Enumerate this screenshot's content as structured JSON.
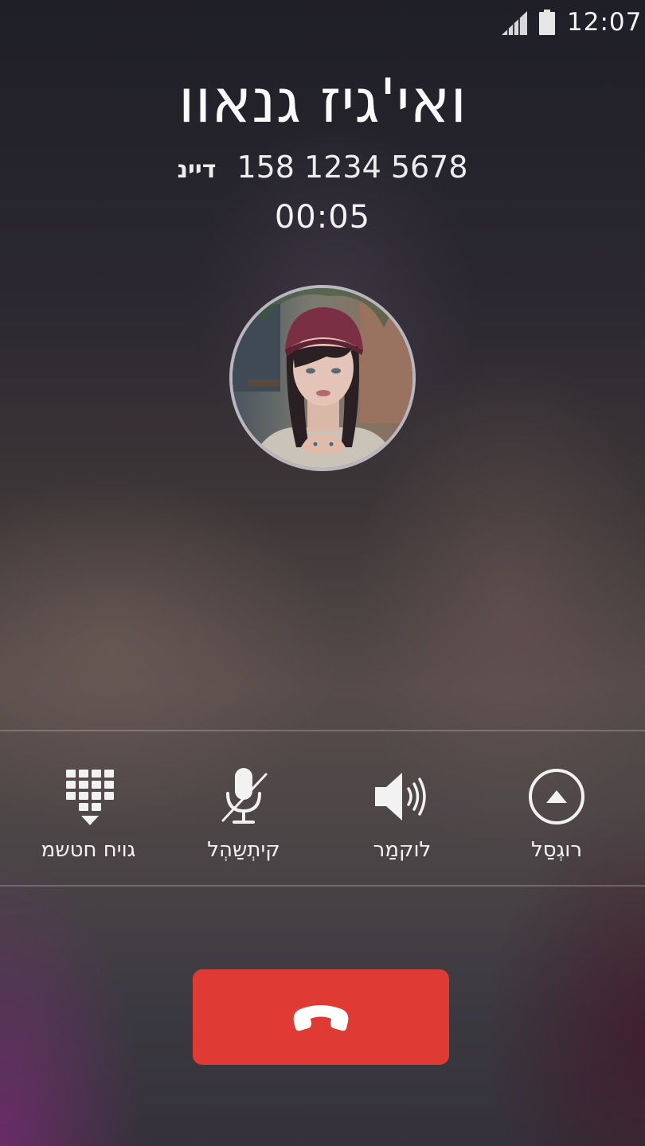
{
  "status_bar": {
    "time": "12:07",
    "signal_icon": "signal-strength-icon",
    "battery_icon": "battery-icon"
  },
  "call": {
    "caller_name": "ואי'גיז גנאוו",
    "number": "158 1234 5678",
    "number_type": "דיינ",
    "duration": "00:05",
    "avatar_icon": "contact-photo"
  },
  "controls": [
    {
      "id": "dialpad",
      "label": "גויח חטשמ",
      "icon": "dialpad-icon"
    },
    {
      "id": "mute",
      "label": "קיתְשַהְל",
      "icon": "microphone-muted-icon"
    },
    {
      "id": "speaker",
      "label": "לוקמַר",
      "icon": "speaker-icon"
    },
    {
      "id": "hold",
      "label": "רוגְסַל",
      "icon": "eject-circle-icon"
    }
  ],
  "end_call": {
    "icon": "phone-hangup-icon",
    "color": "#df3a33"
  }
}
